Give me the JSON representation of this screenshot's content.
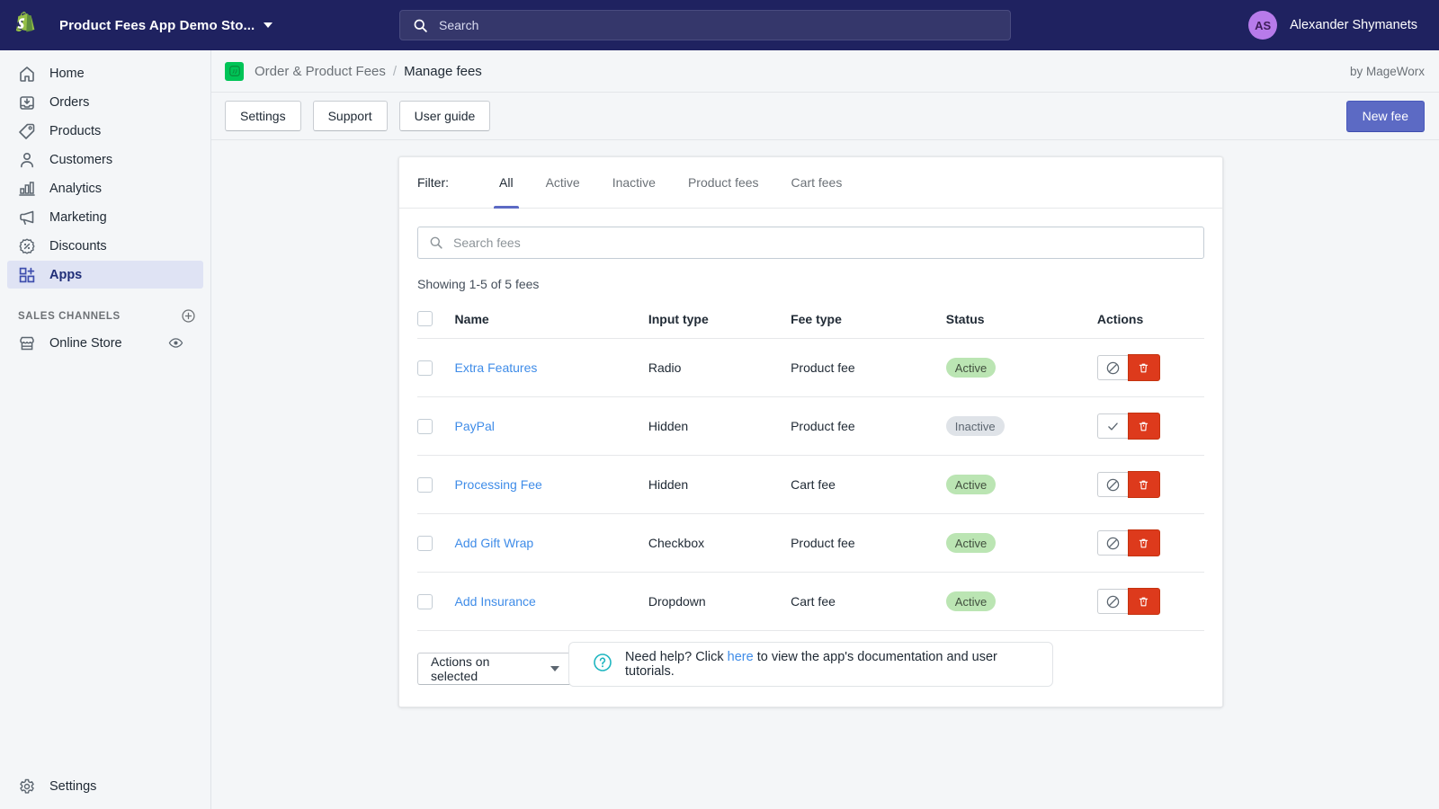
{
  "topbar": {
    "logo_icon": "shopify-bag-logo",
    "store_name": "Product Fees App Demo Sto...",
    "store_switcher_icon": "chevron-down-icon",
    "search": {
      "icon": "search-icon",
      "placeholder": "Search",
      "value": ""
    },
    "user": {
      "initials": "AS",
      "name": "Alexander Shymanets"
    }
  },
  "sidebar": {
    "items": [
      {
        "label": "Home",
        "icon": "home-icon",
        "active": false
      },
      {
        "label": "Orders",
        "icon": "orders-inbox-icon",
        "active": false
      },
      {
        "label": "Products",
        "icon": "product-tag-icon",
        "active": false
      },
      {
        "label": "Customers",
        "icon": "customer-person-icon",
        "active": false
      },
      {
        "label": "Analytics",
        "icon": "analytics-bars-icon",
        "active": false
      },
      {
        "label": "Marketing",
        "icon": "marketing-megaphone-icon",
        "active": false
      },
      {
        "label": "Discounts",
        "icon": "discount-percent-icon",
        "active": false
      },
      {
        "label": "Apps",
        "icon": "apps-grid-plus-icon",
        "active": true
      }
    ],
    "sales_channels": {
      "title": "SALES CHANNELS",
      "add_icon": "plus-circle-icon",
      "channels": [
        {
          "label": "Online Store",
          "icon": "storefront-icon",
          "view_icon": "eye-icon"
        }
      ]
    },
    "settings": {
      "label": "Settings",
      "icon": "gear-icon"
    }
  },
  "app_header": {
    "app_icon": "order-product-fees-app-icon",
    "breadcrumb_app": "Order & Product Fees",
    "breadcrumb_separator": "/",
    "breadcrumb_current": "Manage fees",
    "by_label": "by MageWorx"
  },
  "action_bar": {
    "buttons": [
      "Settings",
      "Support",
      "User guide"
    ],
    "primary_button": "New fee"
  },
  "card": {
    "filter_label": "Filter:",
    "tabs": [
      {
        "label": "All",
        "active": true
      },
      {
        "label": "Active",
        "active": false
      },
      {
        "label": "Inactive",
        "active": false
      },
      {
        "label": "Product fees",
        "active": false
      },
      {
        "label": "Cart fees",
        "active": false
      }
    ],
    "search": {
      "icon": "search-icon",
      "placeholder": "Search fees",
      "value": ""
    },
    "showing": "Showing 1-5 of 5 fees",
    "table": {
      "columns": [
        "Name",
        "Input type",
        "Fee type",
        "Status",
        "Actions"
      ],
      "select_all_checkbox": false,
      "rows": [
        {
          "selected": false,
          "name": "Extra Features",
          "input_type": "Radio",
          "fee_type": "Product fee",
          "status": "Active",
          "status_kind": "active",
          "toggle_icon": "ban-circle-slash-icon",
          "delete_icon": "trash-icon"
        },
        {
          "selected": false,
          "name": "PayPal",
          "input_type": "Hidden",
          "fee_type": "Product fee",
          "status": "Inactive",
          "status_kind": "inactive",
          "toggle_icon": "check-icon",
          "delete_icon": "trash-icon"
        },
        {
          "selected": false,
          "name": "Processing Fee",
          "input_type": "Hidden",
          "fee_type": "Cart fee",
          "status": "Active",
          "status_kind": "active",
          "toggle_icon": "ban-circle-slash-icon",
          "delete_icon": "trash-icon"
        },
        {
          "selected": false,
          "name": "Add Gift Wrap",
          "input_type": "Checkbox",
          "fee_type": "Product fee",
          "status": "Active",
          "status_kind": "active",
          "toggle_icon": "ban-circle-slash-icon",
          "delete_icon": "trash-icon"
        },
        {
          "selected": false,
          "name": "Add Insurance",
          "input_type": "Dropdown",
          "fee_type": "Cart fee",
          "status": "Active",
          "status_kind": "active",
          "toggle_icon": "ban-circle-slash-icon",
          "delete_icon": "trash-icon"
        }
      ]
    },
    "bulk_actions": {
      "label": "Actions on selected",
      "caret_icon": "caret-down-icon"
    }
  },
  "help_banner": {
    "icon": "question-circle-icon",
    "text_before": "Need help? Click",
    "link": "here",
    "text_after": "to view the app's documentation and user tutorials."
  },
  "colors": {
    "topbar_bg": "#1f2260",
    "page_bg": "#f4f6f8",
    "primary": "#5c6ac4",
    "link": "#3f8ce8",
    "badge_active_bg": "#bbe5b3",
    "badge_inactive_bg": "#dfe3e8",
    "delete_red": "#dd3a1c",
    "app_icon_green": "#00c457",
    "avatar_purple": "#b77bea"
  }
}
